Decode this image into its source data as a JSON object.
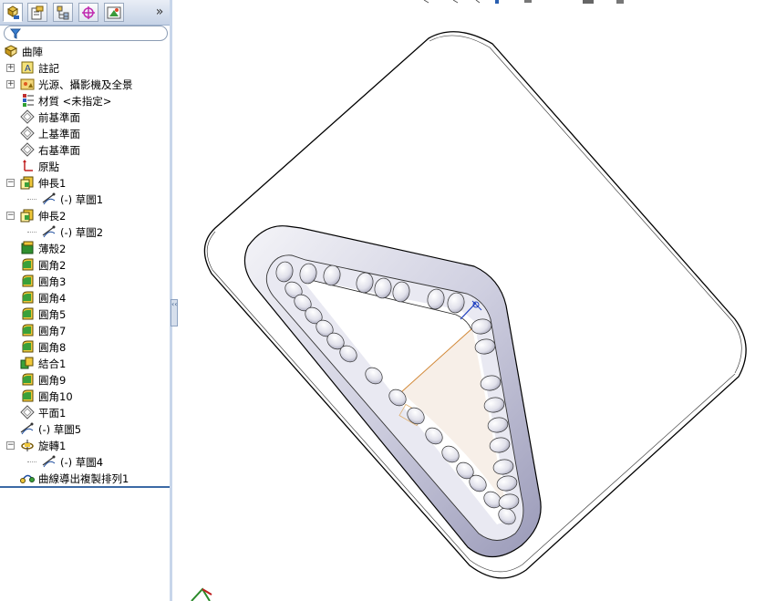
{
  "window": {
    "title": ""
  },
  "toolbar": {
    "tabs": [
      {
        "name": "feature-manager-tab",
        "icon": "feature-tree-icon"
      },
      {
        "name": "property-manager-tab",
        "icon": "property-icon"
      },
      {
        "name": "configuration-manager-tab",
        "icon": "configuration-icon"
      },
      {
        "name": "dimxpert-tab",
        "icon": "crosshair-icon"
      },
      {
        "name": "display-manager-tab",
        "icon": "display-icon"
      }
    ],
    "more_glyph": "»"
  },
  "filter": {
    "icon": "filter-icon"
  },
  "tree": {
    "root": {
      "label": "曲陣",
      "icon": "part-icon"
    },
    "items": [
      {
        "label": "註記",
        "icon": "annotation-icon",
        "expander": "+",
        "indent": 0
      },
      {
        "label": "光源、攝影機及全景",
        "icon": "lights-icon",
        "expander": "+",
        "indent": 0
      },
      {
        "label": "材質 <未指定>",
        "icon": "material-icon",
        "expander": "",
        "indent": 0
      },
      {
        "label": "前基準面",
        "icon": "plane-icon",
        "expander": "",
        "indent": 0
      },
      {
        "label": "上基準面",
        "icon": "plane-icon",
        "expander": "",
        "indent": 0
      },
      {
        "label": "右基準面",
        "icon": "plane-icon",
        "expander": "",
        "indent": 0
      },
      {
        "label": "原點",
        "icon": "origin-icon",
        "expander": "",
        "indent": 0
      },
      {
        "label": "伸長1",
        "icon": "extrude-icon",
        "expander": "−",
        "indent": 0
      },
      {
        "label": "(-) 草圖1",
        "icon": "sketch-icon",
        "expander": "",
        "indent": 1
      },
      {
        "label": "伸長2",
        "icon": "extrude-icon",
        "expander": "−",
        "indent": 0
      },
      {
        "label": "(-) 草圖2",
        "icon": "sketch-icon",
        "expander": "",
        "indent": 1
      },
      {
        "label": "薄殼2",
        "icon": "shell-icon",
        "expander": "",
        "indent": 0
      },
      {
        "label": "圓角2",
        "icon": "fillet-icon",
        "expander": "",
        "indent": 0
      },
      {
        "label": "圓角3",
        "icon": "fillet-icon",
        "expander": "",
        "indent": 0
      },
      {
        "label": "圓角4",
        "icon": "fillet-icon",
        "expander": "",
        "indent": 0
      },
      {
        "label": "圓角5",
        "icon": "fillet-icon",
        "expander": "",
        "indent": 0
      },
      {
        "label": "圓角7",
        "icon": "fillet-icon",
        "expander": "",
        "indent": 0
      },
      {
        "label": "圓角8",
        "icon": "fillet-icon",
        "expander": "",
        "indent": 0
      },
      {
        "label": "結合1",
        "icon": "combine-icon",
        "expander": "",
        "indent": 0
      },
      {
        "label": "圓角9",
        "icon": "fillet-icon",
        "expander": "",
        "indent": 0
      },
      {
        "label": "圓角10",
        "icon": "fillet-icon",
        "expander": "",
        "indent": 0
      },
      {
        "label": "平面1",
        "icon": "plane-icon",
        "expander": "",
        "indent": 0
      },
      {
        "label": "(-) 草圖5",
        "icon": "sketch-icon",
        "expander": "",
        "indent": 0
      },
      {
        "label": "旋轉1",
        "icon": "revolve-icon",
        "expander": "−",
        "indent": 0
      },
      {
        "label": "(-) 草圖4",
        "icon": "sketch-icon",
        "expander": "",
        "indent": 1
      },
      {
        "label": "曲線導出複製排列1",
        "icon": "curve-pattern-icon",
        "expander": "",
        "indent": 0
      }
    ]
  },
  "panel_handle": {
    "glyph": "‹‹"
  },
  "viewport": {
    "model": "triangular-pocket-plate-with-bead-pattern",
    "triad_icon": "view-triad-icon"
  },
  "colors": {
    "panel_border": "#6d8fb8",
    "accent_blue": "#3c6aa5",
    "model_edge": "#000000",
    "selection_blue": "#1f3fbf"
  }
}
